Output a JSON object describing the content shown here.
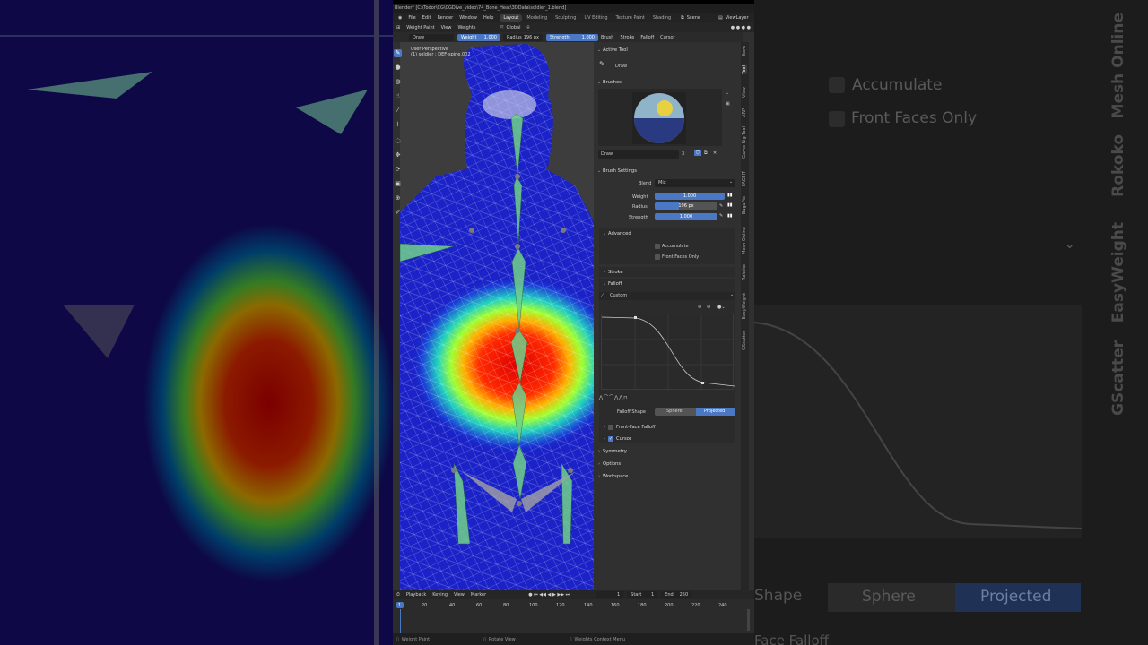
{
  "window": {
    "title": "Blender* [C:\\Todor\\CG\\CGDive_video\\74_Bone_Heat\\3DData\\soldier_1.blend]"
  },
  "menubar": {
    "menus": [
      "File",
      "Edit",
      "Render",
      "Window",
      "Help"
    ],
    "workspace_tabs": [
      "Layout",
      "Modeling",
      "Sculpting",
      "UV Editing",
      "Texture Paint",
      "Shading"
    ],
    "active_workspace": "Layout",
    "scene": "Scene",
    "view_layer": "ViewLayer"
  },
  "header": {
    "mode": "Weight Paint",
    "menus": [
      "View",
      "Weights"
    ],
    "orientation": "Global"
  },
  "toolsettings": {
    "brush_name": "Draw",
    "weight_label": "Weight",
    "weight_value": "1.000",
    "radius_label": "Radius",
    "radius_value": "196 px",
    "strength_label": "Strength",
    "strength_value": "1.000",
    "menus": [
      "Brush",
      "Stroke",
      "Falloff",
      "Cursor"
    ]
  },
  "viewport": {
    "perspective": "User Perspective",
    "object": "(1) soldier : DEF-spine.002"
  },
  "properties": {
    "active_tool_header": "Active Tool",
    "active_tool": "Draw",
    "brushes_header": "Brushes",
    "brush_name": "Draw",
    "brush_users": "3",
    "brush_settings_header": "Brush Settings",
    "blend_label": "Blend",
    "blend_value": "Mix",
    "weight_label": "Weight",
    "weight_value": "1.000",
    "radius_label": "Radius",
    "radius_value": "196 px",
    "strength_label": "Strength",
    "strength_value": "1.000",
    "advanced_header": "Advanced",
    "accumulate": "Accumulate",
    "front_faces_only": "Front Faces Only",
    "stroke_header": "Stroke",
    "falloff_header": "Falloff",
    "falloff_preset": "Custom",
    "falloff_shape_label": "Falloff Shape",
    "falloff_shape_options": [
      "Sphere",
      "Projected"
    ],
    "falloff_shape_selected": "Projected",
    "front_face_falloff": "Front-Face Falloff",
    "cursor": "Cursor",
    "symmetry_header": "Symmetry",
    "options_header": "Options",
    "workspace_header": "Workspace"
  },
  "sidebar_tabs": [
    "Item",
    "Tool",
    "View",
    "ARP",
    "Game Rig Tool",
    "FACEIT",
    "BagaPie",
    "Mesh Online",
    "Rokoko",
    "EasyWeight",
    "GScatter"
  ],
  "active_sidebar_tab": "Tool",
  "timeline": {
    "menus": [
      "Playback",
      "Keying",
      "View",
      "Marker"
    ],
    "current_frame": "1",
    "start_label": "Start",
    "start_value": "1",
    "end_label": "End",
    "end_value": "250",
    "ticks": [
      "1",
      "20",
      "40",
      "60",
      "80",
      "100",
      "120",
      "140",
      "160",
      "180",
      "200",
      "220",
      "240"
    ]
  },
  "statusbar": {
    "items": [
      "Weight Paint",
      "Rotate View",
      "Weights Context Menu"
    ]
  },
  "background": {
    "right_labels": [
      "Accumulate",
      "Front Faces Only",
      "Sphere",
      "Projected",
      "Shape",
      "Face Falloff"
    ],
    "right_tabs": [
      "Mesh Online",
      "Rokoko",
      "EasyWeight",
      "GScatter"
    ]
  },
  "colors": {
    "accent": "#4a78c4",
    "panel": "#303030",
    "header": "#262626"
  }
}
